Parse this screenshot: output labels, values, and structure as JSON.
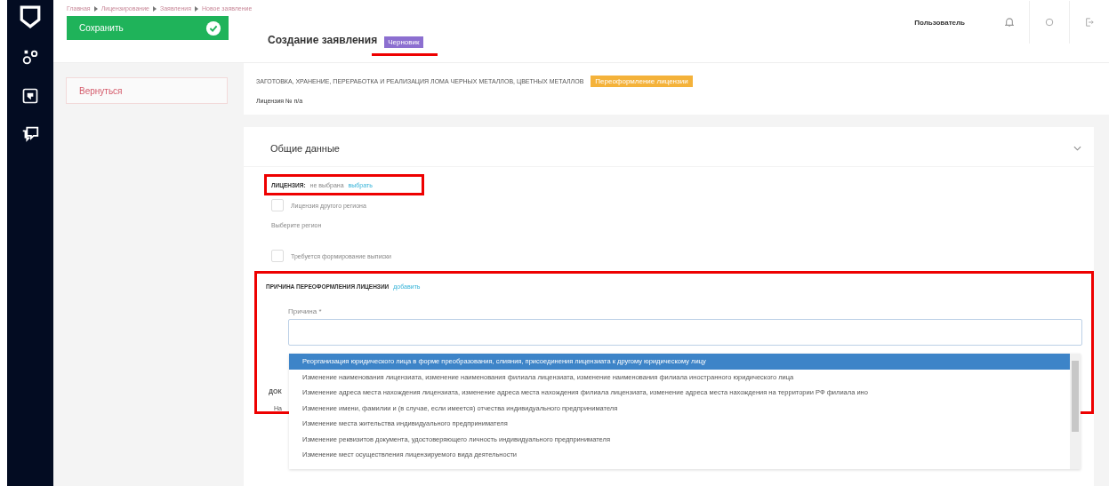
{
  "breadcrumbs": [
    "Главная",
    "Лицензирование",
    "Заявления",
    "Новое заявление"
  ],
  "save_button": "Сохранить",
  "page_title": "Создание заявления",
  "status_badge": "Черновик",
  "user": "Пользователь",
  "back_button": "Вернуться",
  "activity": {
    "title": "ЗАГОТОВКА, ХРАНЕНИЕ, ПЕРЕРАБОТКА И РЕАЛИЗАЦИЯ ЛОМА ЧЕРНЫХ МЕТАЛЛОВ, ЦВЕТНЫХ МЕТАЛЛОВ",
    "badge": "Переоформление лицензии",
    "license_number": "Лицензия № п/а"
  },
  "section": {
    "title": "Общие данные",
    "expanded": true
  },
  "license": {
    "label": "ЛИЦЕНЗИЯ:",
    "value": "не выбрана",
    "link": "выбрать"
  },
  "checkboxes": [
    {
      "label": "Лицензия другого региона",
      "checked": false
    },
    {
      "label": "Требуется формирование выписки",
      "checked": false
    }
  ],
  "region_label": "Выберите регион",
  "reason_block": {
    "label": "ПРИЧИНА ПЕРЕОФОРМЛЕНИЯ ЛИЦЕНЗИИ",
    "link": "добавить",
    "field_label": "Причина *"
  },
  "hidden_behind": [
    "ДОК",
    "На"
  ],
  "options": [
    {
      "label": "Реорганизация юридического лица в форме преобразования, слияния, присоединения лицензиата к другому юридическому лицу",
      "selected": true
    },
    {
      "label": "Изменение наименования лицензиата, изменение наименования филиала лицензиата, изменение наименования филиала иностранного юридического лица",
      "selected": false
    },
    {
      "label": "Изменение адреса места нахождения лицензиата, изменение адреса места нахождения филиала лицензиата, изменение адреса места нахождения на территории РФ филиала ино",
      "selected": false
    },
    {
      "label": "Изменение имени, фамилии и (в случае, если имеется) отчества индивидуального предпринимателя",
      "selected": false
    },
    {
      "label": "Изменение места жительства индивидуального предпринимателя",
      "selected": false
    },
    {
      "label": "Изменение реквизитов документа, удостоверяющего личность индивидуального предпринимателя",
      "selected": false
    },
    {
      "label": "Изменение мест осуществления лицензируемого вида деятельности",
      "selected": false
    }
  ]
}
